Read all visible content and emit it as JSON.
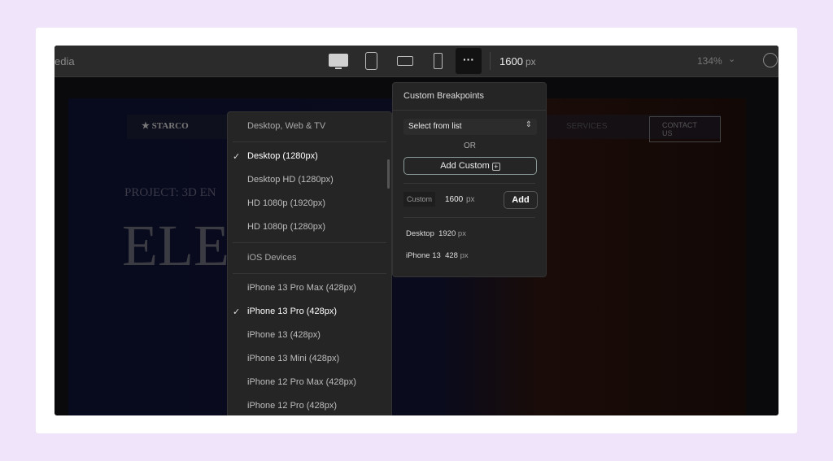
{
  "toolbar": {
    "left_text": "edia",
    "width_value": "1600",
    "width_unit": "px",
    "zoom": "134%",
    "devices": [
      "desktop-icon",
      "tablet-icon",
      "tablet-landscape-icon",
      "phone-icon",
      "more-icon"
    ]
  },
  "site": {
    "logo": "STARCO",
    "nav_item": "SERVICES",
    "cta": "CONTACT US",
    "subtitle": "PROJECT: 3D EN",
    "title": "ELE         CE+"
  },
  "device_list": {
    "groups": [
      {
        "header": "Desktop, Web & TV",
        "items": [
          {
            "label": "Desktop (1280px)",
            "checked": true
          },
          {
            "label": "Desktop HD (1280px)",
            "checked": false
          },
          {
            "label": "HD 1080p (1920px)",
            "checked": false
          },
          {
            "label": "HD 1080p (1280px)",
            "checked": false
          }
        ]
      },
      {
        "header": "iOS Devices",
        "items": [
          {
            "label": "iPhone 13 Pro Max (428px)",
            "checked": false
          },
          {
            "label": "iPhone 13 Pro (428px)",
            "checked": true
          },
          {
            "label": "iPhone 13 (428px)",
            "checked": false
          },
          {
            "label": "iPhone 13 Mini (428px)",
            "checked": false
          },
          {
            "label": "iPhone 12 Pro Max (428px)",
            "checked": false
          },
          {
            "label": "iPhone 12 Pro (428px)",
            "checked": false
          }
        ]
      }
    ]
  },
  "custom_breakpoints": {
    "title": "Custom Breakpoints",
    "select_placeholder": "Select from list",
    "or": "OR",
    "add_custom": "Add Custom",
    "custom_label": "Custom",
    "custom_value": "1600",
    "custom_unit": "px",
    "add": "Add",
    "saved": [
      {
        "name": "Desktop",
        "value": "1920",
        "unit": "px"
      },
      {
        "name": "iPhone 13",
        "value": "428",
        "unit": "px"
      }
    ]
  }
}
